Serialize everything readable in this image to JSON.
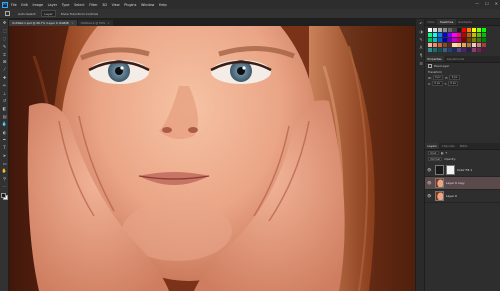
{
  "app": {
    "logo": "Ps"
  },
  "menubar": {
    "items": [
      "File",
      "Edit",
      "Image",
      "Layer",
      "Type",
      "Select",
      "Filter",
      "3D",
      "View",
      "Plugins",
      "Window",
      "Help"
    ],
    "window_controls": [
      "—",
      "☐",
      "✕"
    ]
  },
  "options": {
    "auto_select_label": "Auto-Select:",
    "target": "Layer",
    "transform_label": "Show Transform Controls"
  },
  "tabs": [
    {
      "label": "Untitled-1.psd @ 66.7% (Layer 0, RGB/8)",
      "active": true
    },
    {
      "label": "Untitled-2 @ 50%",
      "active": false
    }
  ],
  "tools": [
    {
      "icon": "move-tool-icon",
      "glyph": "✥"
    },
    {
      "icon": "marquee-tool-icon",
      "glyph": "⬚"
    },
    {
      "icon": "lasso-tool-icon",
      "glyph": "◌"
    },
    {
      "icon": "quick-select-icon",
      "glyph": "✎"
    },
    {
      "icon": "crop-tool-icon",
      "glyph": "⌗"
    },
    {
      "icon": "frame-tool-icon",
      "glyph": "⊠"
    },
    {
      "icon": "eyedropper-icon",
      "glyph": "⁄"
    },
    {
      "icon": "healing-brush-icon",
      "glyph": "✚"
    },
    {
      "icon": "brush-tool-icon",
      "glyph": "✏"
    },
    {
      "icon": "clone-stamp-icon",
      "glyph": "⊥"
    },
    {
      "icon": "history-brush-icon",
      "glyph": "↺"
    },
    {
      "icon": "eraser-icon",
      "glyph": "◧"
    },
    {
      "icon": "gradient-tool-icon",
      "glyph": "▤"
    },
    {
      "icon": "blur-tool-icon",
      "glyph": "💧"
    },
    {
      "icon": "dodge-tool-icon",
      "glyph": "◐"
    },
    {
      "icon": "pen-tool-icon",
      "glyph": "✒"
    },
    {
      "icon": "type-tool-icon",
      "glyph": "T"
    },
    {
      "icon": "path-select-icon",
      "glyph": "➤"
    },
    {
      "icon": "rectangle-tool-icon",
      "glyph": "▭"
    },
    {
      "icon": "hand-tool-icon",
      "glyph": "✋"
    },
    {
      "icon": "zoom-tool-icon",
      "glyph": "⚲"
    },
    {
      "icon": "more-tools-icon",
      "glyph": "⋯"
    }
  ],
  "panel_icons": [
    {
      "icon": "history-icon",
      "glyph": "↶"
    },
    {
      "icon": "adjustments-icon",
      "glyph": "◑"
    },
    {
      "icon": "brush-settings-icon",
      "glyph": "✎"
    },
    {
      "icon": "character-icon",
      "glyph": "A"
    },
    {
      "icon": "paragraph-icon",
      "glyph": "¶"
    },
    {
      "icon": "properties-icon",
      "glyph": "☰"
    }
  ],
  "swatches_panel": {
    "tabs": [
      {
        "label": "Color",
        "active": false
      },
      {
        "label": "Swatches",
        "active": true
      },
      {
        "label": "Gradients",
        "active": false
      }
    ],
    "colors": [
      "#ffffff",
      "#d9d9d9",
      "#b3b3b3",
      "#8c8c8c",
      "#666666",
      "#404040",
      "#1a1a1a",
      "#ff0000",
      "#ff8000",
      "#ffff00",
      "#80ff00",
      "#00ff00",
      "#00ff80",
      "#00ffff",
      "#0080ff",
      "#0000ff",
      "#8000ff",
      "#ff00ff",
      "#ff0080",
      "#c00000",
      "#c06000",
      "#c0c000",
      "#60c000",
      "#00c000",
      "#00c060",
      "#00c0c0",
      "#0060c0",
      "#0000c0",
      "#6000c0",
      "#c000c0",
      "#c00060",
      "#800000",
      "#804000",
      "#808000",
      "#408000",
      "#008000",
      "#f2b6a0",
      "#e88c6c",
      "#c8643c",
      "#8c4a2a",
      "#5a2e18",
      "#ffd9b3",
      "#ffbf80",
      "#e6a35c",
      "#b37a3d",
      "#f0c8c8",
      "#d48080",
      "#a04040",
      "#2c8c8c",
      "#1a6e6e",
      "#145050",
      "#3d5c8c",
      "#27406e",
      "#1a2e50",
      "#5c3d8c",
      "#40276e",
      "#2e1a50",
      "#8c3d6e",
      "#6e2755",
      "#501a3d"
    ]
  },
  "properties_panel": {
    "tabs": [
      {
        "label": "Properties",
        "active": true
      },
      {
        "label": "Adjustments",
        "active": false
      }
    ],
    "kind": "Pixel Layer",
    "section": "Transform",
    "w": "W:",
    "h": "H:",
    "x": "X:",
    "y": "Y:",
    "w_val": "0 px",
    "h_val": "0 px",
    "x_val": "0 px",
    "y_val": "0 px"
  },
  "layers_panel": {
    "tabs": [
      {
        "label": "Layers",
        "active": true
      },
      {
        "label": "Channels",
        "active": false
      },
      {
        "label": "Paths",
        "active": false
      }
    ],
    "kind_filter": "Kind",
    "blend_mode": "Normal",
    "opacity_label": "Opacity:",
    "layers": [
      {
        "name": "Color Fill 1",
        "selected": false,
        "type": "fill"
      },
      {
        "name": "Layer 0 copy",
        "selected": true,
        "type": "image"
      },
      {
        "name": "Layer 0",
        "selected": false,
        "type": "image"
      }
    ]
  }
}
